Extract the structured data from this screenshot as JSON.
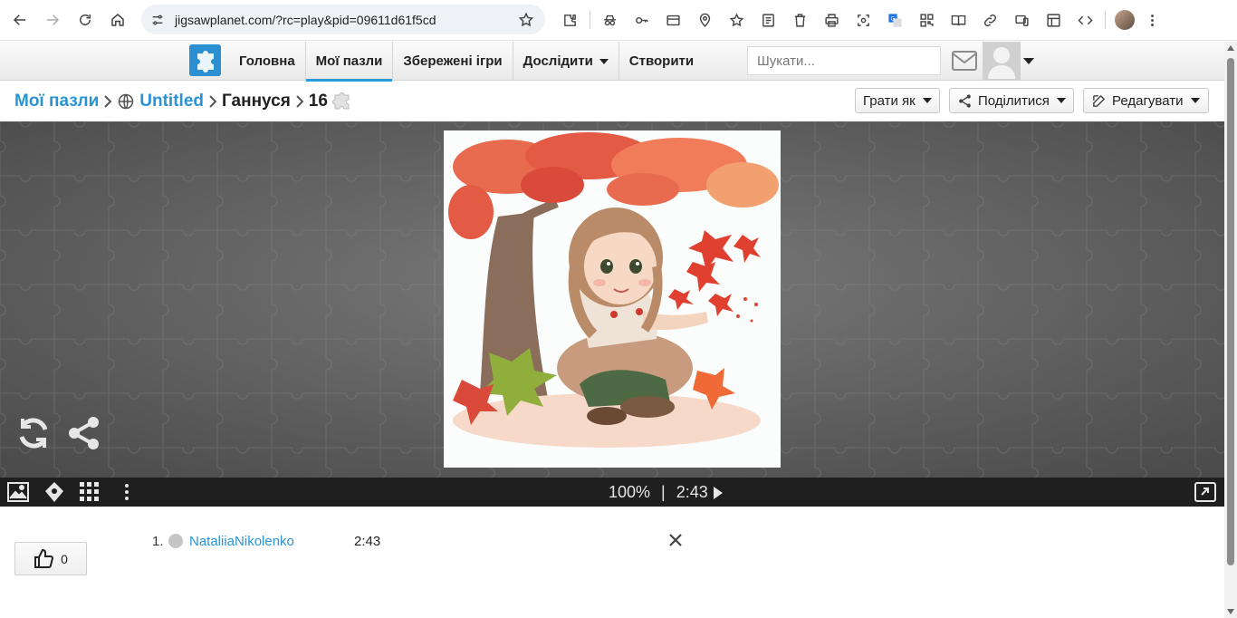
{
  "browser": {
    "url": "jigsawplanet.com/?rc=play&pid=09611d61f5cd",
    "icons": [
      "back-icon",
      "forward-icon",
      "reload-icon",
      "home-icon",
      "site-info-icon",
      "bookmark-star-icon"
    ],
    "extensions": [
      "extensions-icon",
      "incognito-icon",
      "key-icon",
      "card-icon",
      "location-pin-icon",
      "favorites-icon",
      "reading-list-icon",
      "delete-icon",
      "print-icon",
      "screenshot-icon",
      "translate-icon",
      "qr-code-icon",
      "reader-mode-icon",
      "link-icon",
      "devices-icon",
      "layout-icon",
      "code-icon",
      "profile-avatar",
      "menu-icon"
    ]
  },
  "header": {
    "nav": [
      {
        "label": "Головна",
        "active": false,
        "dropdown": false
      },
      {
        "label": "Мої пазли",
        "active": true,
        "dropdown": false
      },
      {
        "label": "Збережені ігри",
        "active": false,
        "dropdown": false
      },
      {
        "label": "Дослідити",
        "active": false,
        "dropdown": true
      },
      {
        "label": "Створити",
        "active": false,
        "dropdown": false
      }
    ],
    "search_placeholder": "Шукати..."
  },
  "breadcrumb": {
    "root": "Мої пазли",
    "album": "Untitled",
    "title": "Ганнуся",
    "pieces": "16"
  },
  "actions": {
    "play_as": "Грати як",
    "share": "Поділитися",
    "edit": "Редагувати"
  },
  "player": {
    "progress": "100%",
    "separator": "|",
    "time": "2:43"
  },
  "likes": {
    "count": "0"
  },
  "scores": [
    {
      "rank": "1.",
      "name": "NataliiaNikolenko",
      "time": "2:43"
    }
  ],
  "colors": {
    "accent": "#2a93d5",
    "logo": "#2b8fd2",
    "toolbar": "#1f1f1f",
    "stage": "#6c6c6c"
  }
}
